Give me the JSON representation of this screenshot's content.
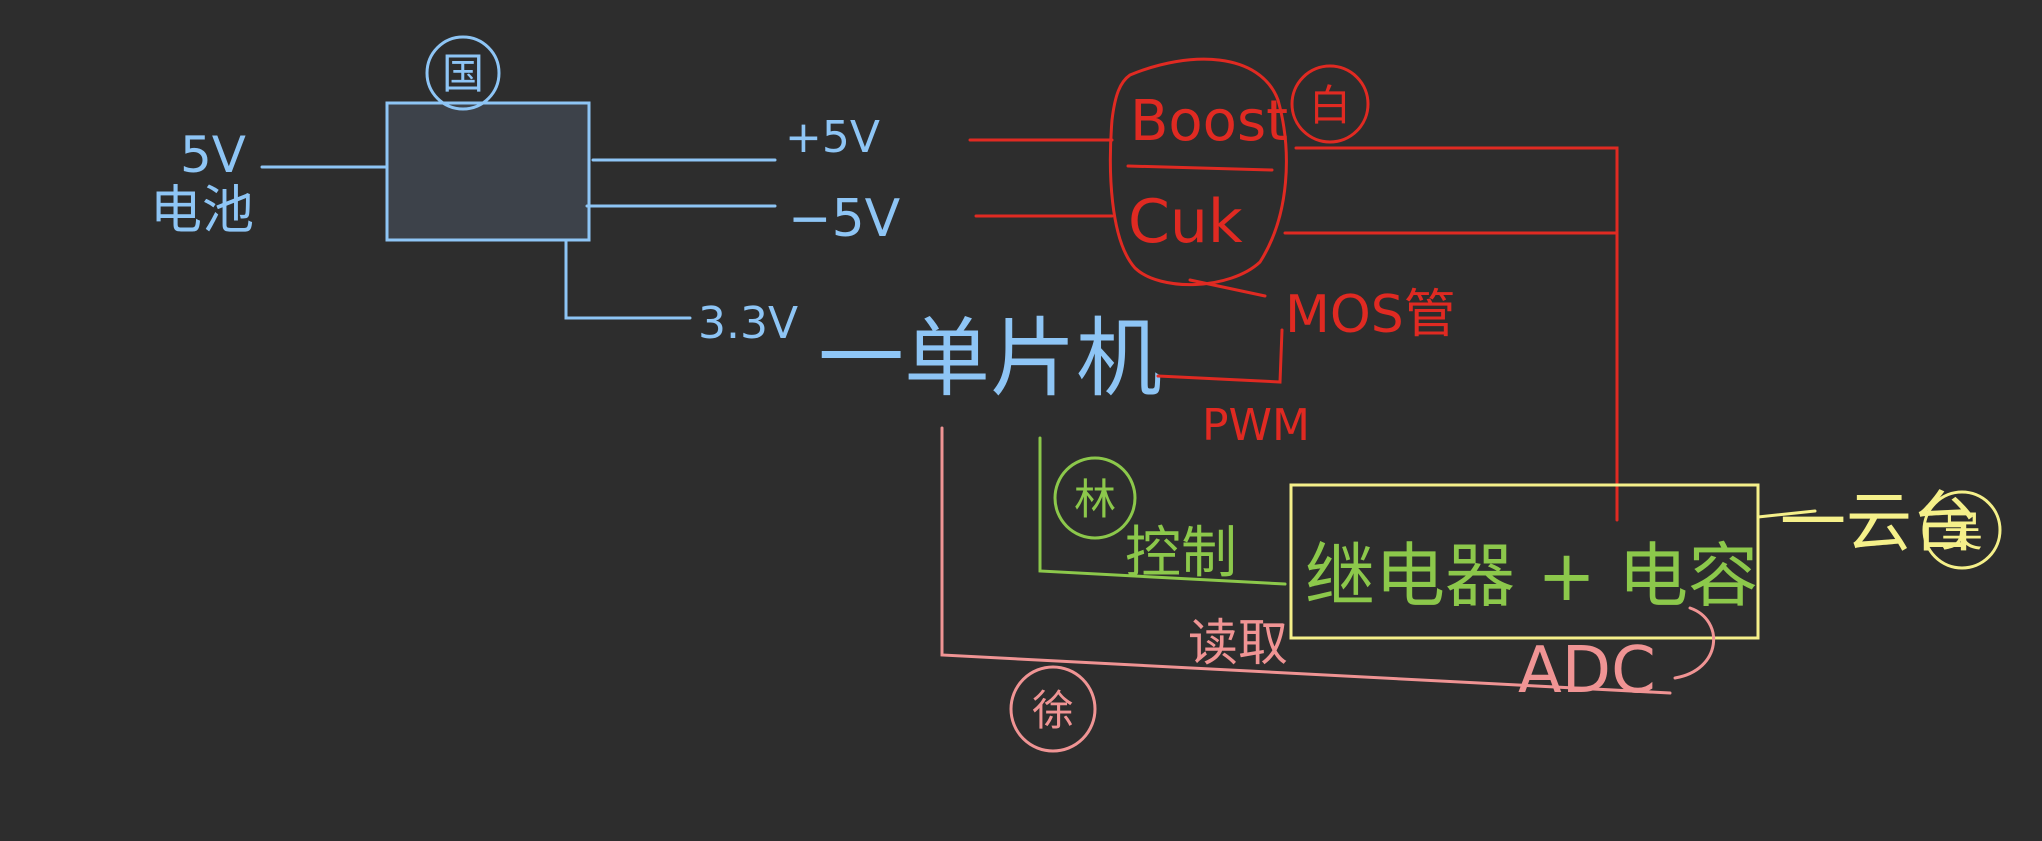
{
  "colors": {
    "background": "#2d2d2d",
    "blue": "#8ec5f5",
    "red": "#e02a22",
    "green": "#8cc84b",
    "yellow": "#f5f08a",
    "pink": "#f09494",
    "box_fill": "#3d424a"
  },
  "power": {
    "input_voltage": "5V",
    "input_label": "电池",
    "badge": "国",
    "out_plus": "+5V",
    "out_minus": "−5V",
    "out_33": "3.3V"
  },
  "mcu": {
    "label": "一单片机"
  },
  "converter": {
    "boost": "Boost",
    "cuk": "Cuk",
    "badge": "白",
    "mos": "MOS管",
    "pwm": "PWM"
  },
  "relay": {
    "label": "继电器 + 电容",
    "badge": "林",
    "control": "控制",
    "gun": "一云台",
    "gun_badge": "吴"
  },
  "adc": {
    "label": "ADC",
    "read": "读取",
    "badge": "徐"
  }
}
